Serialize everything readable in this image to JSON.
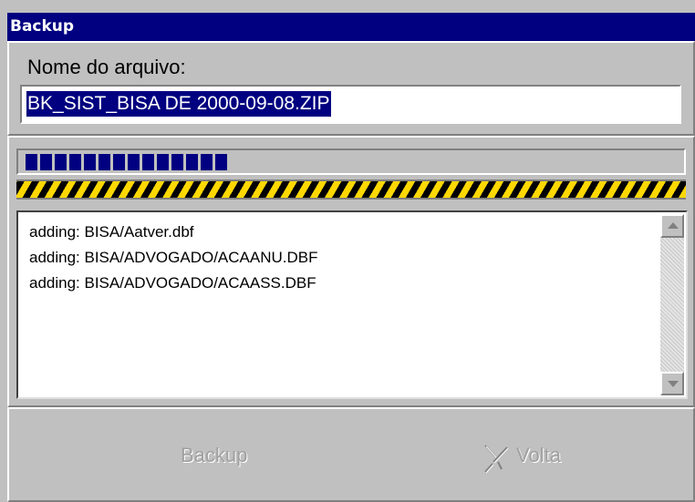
{
  "window": {
    "title": "Backup"
  },
  "file": {
    "label": "Nome do arquivo:",
    "value": "BK_SIST_BISA DE 2000-09-08.ZIP"
  },
  "progress": {
    "fraction": 0.31
  },
  "log": {
    "lines": [
      "adding: BISA/Aatver.dbf",
      "adding: BISA/ADVOGADO/ACAANU.DBF",
      "adding: BISA/ADVOGADO/ACAASS.DBF"
    ]
  },
  "buttons": {
    "backup_label": "Backup",
    "volta_label": "Volta",
    "volta_icon": "exit-icon"
  },
  "colors": {
    "title_bar": "#000080",
    "progress_block": "#000080",
    "hazard_yellow": "#ffd800",
    "hazard_black": "#000000",
    "disabled_text": "#a0a0a0"
  }
}
